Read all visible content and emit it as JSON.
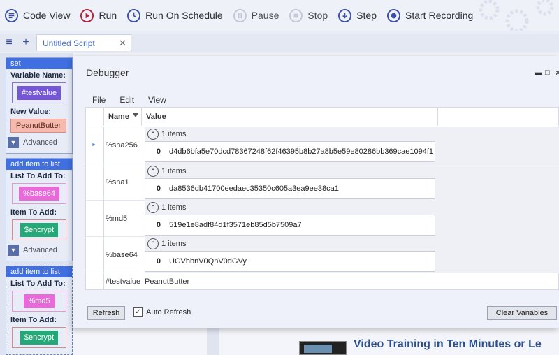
{
  "toolbar": {
    "code_view": "Code View",
    "run": "Run",
    "run_on_schedule": "Run On Schedule",
    "pause": "Pause",
    "stop": "Stop",
    "step": "Step",
    "start_recording": "Start Recording"
  },
  "tabs": {
    "script_tab": "Untitled Script"
  },
  "script": {
    "set_block": {
      "header": "set",
      "variable_name_label": "Variable Name:",
      "variable_name_value": "#testvalue",
      "new_value_label": "New Value:",
      "new_value_value": "PeanutButter",
      "advanced": "Advanced"
    },
    "add_item_1": {
      "header": "add item to list",
      "list_label": "List To Add To:",
      "list_value": "%base64",
      "item_label": "Item To Add:",
      "item_value": "$encrypt",
      "advanced": "Advanced"
    },
    "add_item_2": {
      "header": "add item to list",
      "list_label": "List To Add To:",
      "list_value": "%md5",
      "item_label": "Item To Add:",
      "item_value": "$encrypt"
    }
  },
  "debugger": {
    "title": "Debugger",
    "menu": {
      "file": "File",
      "edit": "Edit",
      "view": "View"
    },
    "columns": {
      "name": "Name",
      "value": "Value"
    },
    "rows": [
      {
        "name": "%sha256",
        "count": "1 items",
        "index": "0",
        "value": "d4db6bfa5e70dcd78367248f62f46395b8b27a8b5e59e80286bb369cae1094f1"
      },
      {
        "name": "%sha1",
        "count": "1 items",
        "index": "0",
        "value": "da8536db41700eedaec35350c605a3ea9ee38ca1"
      },
      {
        "name": "%md5",
        "count": "1 items",
        "index": "0",
        "value": "519e1e8adf84d1f3571eb85d5b7509a7"
      },
      {
        "name": "%base64",
        "count": "1 items",
        "index": "0",
        "value": "UGVhbnV0QnV0dGVy"
      },
      {
        "name": "#testvalue",
        "value": "PeanutButter"
      }
    ],
    "refresh_button": "Refresh",
    "auto_refresh_label": "Auto Refresh",
    "auto_refresh_checked": true,
    "clear_variables_button": "Clear Variables"
  },
  "background": {
    "video_title": "Video Training in Ten Minutes or Le"
  },
  "colors": {
    "accent": "#2d4fa8",
    "block_header": "#3f6fe0",
    "chip_purple": "#7357d6",
    "chip_pink": "#e86ad8",
    "chip_green": "#25a778",
    "chip_salmon": "#f6b9ad"
  }
}
